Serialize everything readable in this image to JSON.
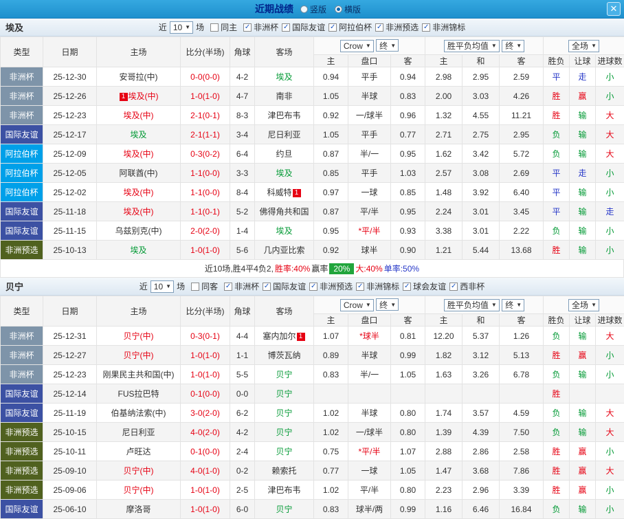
{
  "topbar": {
    "title": "近期战绩",
    "vertical": "竖版",
    "horizontal": "横版",
    "close": "✕"
  },
  "ui": {
    "arrow": "▼",
    "check": "✓",
    "card": "1"
  },
  "type_colors": {
    "非洲杯": "#7e94a9",
    "国际友谊": "#3c51a3",
    "阿拉伯杯": "#00a0e9",
    "非洲预选": "#50611f"
  },
  "result_colors": {
    "胜": "red",
    "赢": "red",
    "大": "red",
    "平": "blue",
    "走": "blue",
    "负": "green",
    "输": "green",
    "小": "green"
  },
  "table_header": {
    "cols": [
      "类型",
      "日期",
      "主场",
      "比分(半场)",
      "角球",
      "客场"
    ],
    "sub": [
      "主",
      "盘口",
      "客",
      "主",
      "和",
      "客",
      "胜负",
      "让球",
      "进球数"
    ],
    "selects": {
      "book": "Crow",
      "final1": "终",
      "avg": "胜平负均值",
      "final2": "终",
      "scope": "全场"
    }
  },
  "sections": [
    {
      "team": "埃及",
      "filter": {
        "near": "近",
        "count": "10",
        "unit": "场",
        "same_label": "同主",
        "same_checked": false,
        "comps": [
          {
            "label": "非洲杯",
            "checked": true
          },
          {
            "label": "国际友谊",
            "checked": true
          },
          {
            "label": "阿拉伯杯",
            "checked": true
          },
          {
            "label": "非洲预选",
            "checked": true
          },
          {
            "label": "非洲锦标",
            "checked": true
          }
        ]
      },
      "rows": [
        {
          "type": "非洲杯",
          "date": "25-12-30",
          "home": "安哥拉(中)",
          "hc": "k",
          "away": "埃及",
          "ac": "g",
          "score": "0-0(0-0)",
          "corner": "4-2",
          "o": [
            "0.94",
            "平手",
            "0.94"
          ],
          "avg": [
            "2.98",
            "2.95",
            "2.59"
          ],
          "res": [
            "平",
            "走",
            "小"
          ]
        },
        {
          "type": "非洲杯",
          "date": "25-12-26",
          "home": "埃及(中)",
          "hc": "r",
          "hcard": true,
          "away": "南非",
          "ac": "k",
          "score": "1-0(1-0)",
          "corner": "4-7",
          "o": [
            "1.05",
            "半球",
            "0.83"
          ],
          "avg": [
            "2.00",
            "3.03",
            "4.26"
          ],
          "res": [
            "胜",
            "赢",
            "小"
          ]
        },
        {
          "type": "非洲杯",
          "date": "25-12-23",
          "home": "埃及(中)",
          "hc": "r",
          "away": "津巴布韦",
          "ac": "k",
          "score": "2-1(0-1)",
          "corner": "8-3",
          "o": [
            "0.92",
            "一/球半",
            "0.96"
          ],
          "avg": [
            "1.32",
            "4.55",
            "11.21"
          ],
          "res": [
            "胜",
            "输",
            "大"
          ]
        },
        {
          "type": "国际友谊",
          "date": "25-12-17",
          "home": "埃及",
          "hc": "g",
          "away": "尼日利亚",
          "ac": "k",
          "score": "2-1(1-1)",
          "corner": "3-4",
          "o": [
            "1.05",
            "平手",
            "0.77"
          ],
          "avg": [
            "2.71",
            "2.75",
            "2.95"
          ],
          "res": [
            "负",
            "输",
            "大"
          ]
        },
        {
          "type": "阿拉伯杯",
          "date": "25-12-09",
          "home": "埃及(中)",
          "hc": "r",
          "away": "约旦",
          "ac": "k",
          "score": "0-3(0-2)",
          "corner": "6-4",
          "o": [
            "0.87",
            "半/一",
            "0.95"
          ],
          "avg": [
            "1.62",
            "3.42",
            "5.72"
          ],
          "res": [
            "负",
            "输",
            "大"
          ]
        },
        {
          "type": "阿拉伯杯",
          "date": "25-12-05",
          "home": "阿联酋(中)",
          "hc": "k",
          "away": "埃及",
          "ac": "g",
          "score": "1-1(0-0)",
          "corner": "3-3",
          "o": [
            "0.85",
            "平手",
            "1.03"
          ],
          "avg": [
            "2.57",
            "3.08",
            "2.69"
          ],
          "res": [
            "平",
            "走",
            "小"
          ]
        },
        {
          "type": "阿拉伯杯",
          "date": "25-12-02",
          "home": "埃及(中)",
          "hc": "r",
          "away": "科威特",
          "ac": "k",
          "acard": true,
          "score": "1-1(0-0)",
          "corner": "8-4",
          "o": [
            "0.97",
            "一球",
            "0.85"
          ],
          "avg": [
            "1.48",
            "3.92",
            "6.40"
          ],
          "res": [
            "平",
            "输",
            "小"
          ]
        },
        {
          "type": "国际友谊",
          "date": "25-11-18",
          "home": "埃及(中)",
          "hc": "r",
          "away": "佛得角共和国",
          "ac": "k",
          "score": "1-1(0-1)",
          "corner": "5-2",
          "o": [
            "0.87",
            "平/半",
            "0.95"
          ],
          "avg": [
            "2.24",
            "3.01",
            "3.45"
          ],
          "res": [
            "平",
            "输",
            "走"
          ]
        },
        {
          "type": "国际友谊",
          "date": "25-11-15",
          "home": "乌兹别克(中)",
          "hc": "k",
          "away": "埃及",
          "ac": "g",
          "score": "2-0(2-0)",
          "corner": "1-4",
          "o": [
            "0.95",
            "*平/半",
            "0.93"
          ],
          "avg": [
            "3.38",
            "3.01",
            "2.22"
          ],
          "res": [
            "负",
            "输",
            "小"
          ]
        },
        {
          "type": "非洲预选",
          "date": "25-10-13",
          "home": "埃及",
          "hc": "g",
          "away": "几内亚比索",
          "ac": "k",
          "score": "1-0(1-0)",
          "corner": "5-6",
          "o": [
            "0.92",
            "球半",
            "0.90"
          ],
          "avg": [
            "1.21",
            "5.44",
            "13.68"
          ],
          "res": [
            "胜",
            "输",
            "小"
          ]
        }
      ],
      "summary": {
        "segments": [
          {
            "text": "近10场,胜4平4负2, ",
            "color": "#333333"
          },
          {
            "text": "胜率:40% ",
            "color": "#e60012"
          },
          {
            "text": "赢率",
            "color": "#333333"
          },
          {
            "text": "20%",
            "badge": true
          },
          {
            "text": " 大:40% ",
            "color": "#e60012"
          },
          {
            "text": "单率:50%",
            "color": "#2637c8"
          }
        ]
      }
    },
    {
      "team": "贝宁",
      "filter": {
        "near": "近",
        "count": "10",
        "unit": "场",
        "same_label": "同客",
        "same_checked": false,
        "comps": [
          {
            "label": "非洲杯",
            "checked": true
          },
          {
            "label": "国际友谊",
            "checked": true
          },
          {
            "label": "非洲预选",
            "checked": true
          },
          {
            "label": "非洲锦标",
            "checked": true
          },
          {
            "label": "球会友谊",
            "checked": true
          },
          {
            "label": "西非杯",
            "checked": true
          }
        ]
      },
      "rows": [
        {
          "type": "非洲杯",
          "date": "25-12-31",
          "home": "贝宁(中)",
          "hc": "r",
          "away": "塞内加尔",
          "ac": "k",
          "acard": true,
          "score": "0-3(0-1)",
          "corner": "4-4",
          "o": [
            "1.07",
            "*球半",
            "0.81"
          ],
          "avg": [
            "12.20",
            "5.37",
            "1.26"
          ],
          "res": [
            "负",
            "输",
            "大"
          ]
        },
        {
          "type": "非洲杯",
          "date": "25-12-27",
          "home": "贝宁(中)",
          "hc": "r",
          "away": "博茨瓦纳",
          "ac": "k",
          "score": "1-0(1-0)",
          "corner": "1-1",
          "o": [
            "0.89",
            "半球",
            "0.99"
          ],
          "avg": [
            "1.82",
            "3.12",
            "5.13"
          ],
          "res": [
            "胜",
            "赢",
            "小"
          ]
        },
        {
          "type": "非洲杯",
          "date": "25-12-23",
          "home": "刚果民主共和国(中)",
          "hc": "k",
          "away": "贝宁",
          "ac": "g",
          "score": "1-0(1-0)",
          "corner": "5-5",
          "o": [
            "0.83",
            "半/一",
            "1.05"
          ],
          "avg": [
            "1.63",
            "3.26",
            "6.78"
          ],
          "res": [
            "负",
            "输",
            "小"
          ]
        },
        {
          "type": "国际友谊",
          "date": "25-12-14",
          "home": "FUS拉巴特",
          "hc": "k",
          "away": "贝宁",
          "ac": "g",
          "score": "0-1(0-0)",
          "corner": "0-0",
          "o": [
            "",
            "",
            ""
          ],
          "avg": [
            "",
            "",
            ""
          ],
          "res": [
            "胜",
            "",
            ""
          ]
        },
        {
          "type": "国际友谊",
          "date": "25-11-19",
          "home": "伯基纳法索(中)",
          "hc": "k",
          "away": "贝宁",
          "ac": "g",
          "score": "3-0(2-0)",
          "corner": "6-2",
          "o": [
            "1.02",
            "半球",
            "0.80"
          ],
          "avg": [
            "1.74",
            "3.57",
            "4.59"
          ],
          "res": [
            "负",
            "输",
            "大"
          ]
        },
        {
          "type": "非洲预选",
          "date": "25-10-15",
          "home": "尼日利亚",
          "hc": "k",
          "away": "贝宁",
          "ac": "g",
          "score": "4-0(2-0)",
          "corner": "4-2",
          "o": [
            "1.02",
            "一/球半",
            "0.80"
          ],
          "avg": [
            "1.39",
            "4.39",
            "7.50"
          ],
          "res": [
            "负",
            "输",
            "大"
          ]
        },
        {
          "type": "非洲预选",
          "date": "25-10-11",
          "home": "卢旺达",
          "hc": "k",
          "away": "贝宁",
          "ac": "g",
          "score": "0-1(0-0)",
          "corner": "2-4",
          "o": [
            "0.75",
            "*平/半",
            "1.07"
          ],
          "avg": [
            "2.88",
            "2.86",
            "2.58"
          ],
          "res": [
            "胜",
            "赢",
            "小"
          ]
        },
        {
          "type": "非洲预选",
          "date": "25-09-10",
          "home": "贝宁(中)",
          "hc": "r",
          "away": "赖索托",
          "ac": "k",
          "score": "4-0(1-0)",
          "corner": "0-2",
          "o": [
            "0.77",
            "一球",
            "1.05"
          ],
          "avg": [
            "1.47",
            "3.68",
            "7.86"
          ],
          "res": [
            "胜",
            "赢",
            "大"
          ]
        },
        {
          "type": "非洲预选",
          "date": "25-09-06",
          "home": "贝宁(中)",
          "hc": "r",
          "away": "津巴布韦",
          "ac": "k",
          "score": "1-0(1-0)",
          "corner": "2-5",
          "o": [
            "1.02",
            "平/半",
            "0.80"
          ],
          "avg": [
            "2.23",
            "2.96",
            "3.39"
          ],
          "res": [
            "胜",
            "赢",
            "小"
          ]
        },
        {
          "type": "国际友谊",
          "date": "25-06-10",
          "home": "摩洛哥",
          "hc": "k",
          "away": "贝宁",
          "ac": "g",
          "score": "1-0(1-0)",
          "corner": "6-0",
          "o": [
            "0.83",
            "球半/两",
            "0.99"
          ],
          "avg": [
            "1.16",
            "6.46",
            "16.84"
          ],
          "res": [
            "负",
            "输",
            "小"
          ]
        }
      ]
    }
  ]
}
